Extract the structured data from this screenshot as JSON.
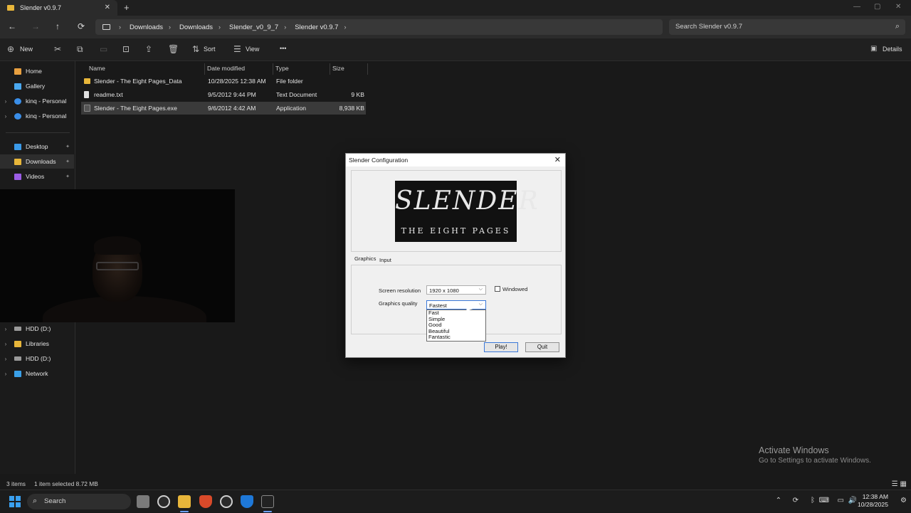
{
  "window": {
    "tab_title": "Slender v0.9.7",
    "close_glyph": "✕",
    "newtab_glyph": "+",
    "min_glyph": "—",
    "max_glyph": "▢",
    "winclose_glyph": "✕"
  },
  "nav": {
    "back": "←",
    "forward": "→",
    "up": "↑",
    "refresh": "⟳"
  },
  "address": {
    "crumbs": [
      "Downloads",
      "Downloads",
      "Slender_v0_9_7",
      "Slender v0.9.7"
    ],
    "sep": "›"
  },
  "search": {
    "placeholder": "Search Slender v0.9.7",
    "icon": "⌕"
  },
  "toolbar": {
    "new_label": "New",
    "sort_label": "Sort",
    "view_label": "View",
    "more": "•••",
    "details_label": "Details"
  },
  "sidebar": {
    "items": [
      {
        "label": "Home",
        "color": "#e8a040"
      },
      {
        "label": "Gallery",
        "color": "#4aa8f0"
      },
      {
        "label": "kinq - Personal",
        "color": "#3a8ee8"
      },
      {
        "label": "kinq - Personal",
        "color": "#3a8ee8"
      },
      {
        "label": "Desktop",
        "color": "#3a9ae8"
      },
      {
        "label": "Downloads",
        "color": "#e8b63a"
      },
      {
        "label": "Videos",
        "color": "#9b5de5"
      },
      {
        "label": "HDD (D:)",
        "color": "#9a9a9a"
      },
      {
        "label": "Libraries",
        "color": "#e8b63a"
      },
      {
        "label": "HDD (D:)",
        "color": "#9a9a9a"
      },
      {
        "label": "Network",
        "color": "#3aa0e8"
      }
    ]
  },
  "columns": [
    "Name",
    "Date modified",
    "Type",
    "Size"
  ],
  "files": [
    {
      "name": "Slender - The Eight Pages_Data",
      "date": "10/28/2025 12:38 AM",
      "type": "File folder",
      "size": ""
    },
    {
      "name": "readme.txt",
      "date": "9/5/2012 9:44 PM",
      "type": "Text Document",
      "size": "9 KB"
    },
    {
      "name": "Slender - The Eight Pages.exe",
      "date": "9/6/2012 4:42 AM",
      "type": "Application",
      "size": "8,938 KB"
    }
  ],
  "dialog": {
    "title": "Slender Configuration",
    "close": "✕",
    "banner_line1": "SLENDER",
    "banner_line2": "THE EIGHT PAGES",
    "tabs": [
      "Graphics",
      "Input"
    ],
    "screen_resolution_label": "Screen resolution",
    "screen_resolution_value": "1920 x 1080",
    "windowed_label": "Windowed",
    "graphics_quality_label": "Graphics quality",
    "graphics_quality_value": "Fastest",
    "quality_options": [
      "Fast",
      "Simple",
      "Good",
      "Beautiful",
      "Fantastic"
    ],
    "play_label": "Play!",
    "quit_label": "Quit",
    "arrow": "⌵"
  },
  "status": {
    "items": "3 items",
    "selected": "1 item selected  8.72 MB"
  },
  "watermark": {
    "line1": "Activate Windows",
    "line2": "Go to Settings to activate Windows."
  },
  "taskbar": {
    "search_label": "Search",
    "search_icon": "⌕",
    "time": "12:38 AM",
    "date": "10/28/2025"
  }
}
